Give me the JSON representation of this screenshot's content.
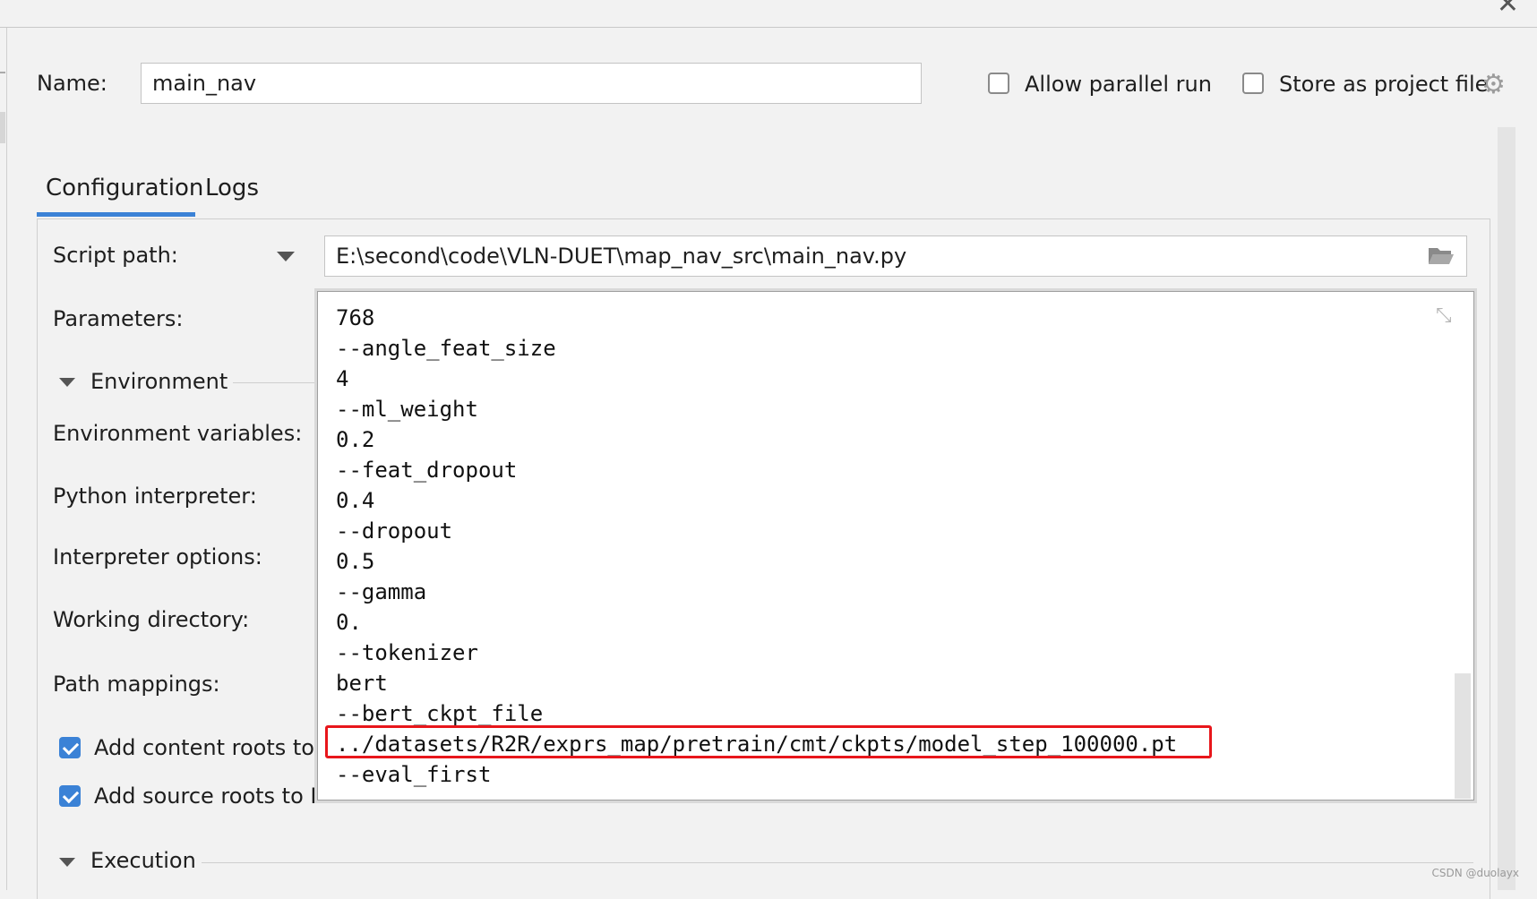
{
  "dialog": {
    "name_label": "Name:",
    "name_value": "main_nav",
    "allow_parallel_label": "Allow parallel run",
    "allow_parallel_checked": false,
    "store_project_label": "Store as project file",
    "store_project_checked": false,
    "icons": {
      "close": "close-icon",
      "settings": "gear-icon"
    }
  },
  "tabs": [
    {
      "label": "Configuration",
      "active": true
    },
    {
      "label": "Logs",
      "active": false
    }
  ],
  "config": {
    "script_path_label": "Script path:",
    "script_path_value": "E:\\second\\code\\VLN-DUET\\map_nav_src\\main_nav.py",
    "parameters_label": "Parameters:",
    "environment_section": "Environment",
    "env_vars_label": "Environment variables:",
    "python_interpreter_label": "Python interpreter:",
    "interpreter_options_label": "Interpreter options:",
    "working_directory_label": "Working directory:",
    "path_mappings_label": "Path mappings:",
    "add_content_roots_label": "Add content roots to",
    "add_content_roots_checked": true,
    "add_source_roots_label": "Add source roots to P",
    "add_source_roots_checked": true,
    "execution_section": "Execution"
  },
  "parameters_popup": {
    "lines": [
      "768",
      "--angle_feat_size",
      "4",
      "--ml_weight",
      "0.2",
      "--feat_dropout",
      "0.4",
      "--dropout",
      "0.5",
      "--gamma",
      "0.",
      "--tokenizer",
      "bert",
      "--bert_ckpt_file",
      "../datasets/R2R/exprs_map/pretrain/cmt/ckpts/model_step_100000.pt",
      "--eval_first"
    ],
    "highlighted_line_index": 14,
    "highlight_color": "#e8161b"
  },
  "accent_color": "#3b82d6",
  "watermark": "CSDN @duolayx"
}
